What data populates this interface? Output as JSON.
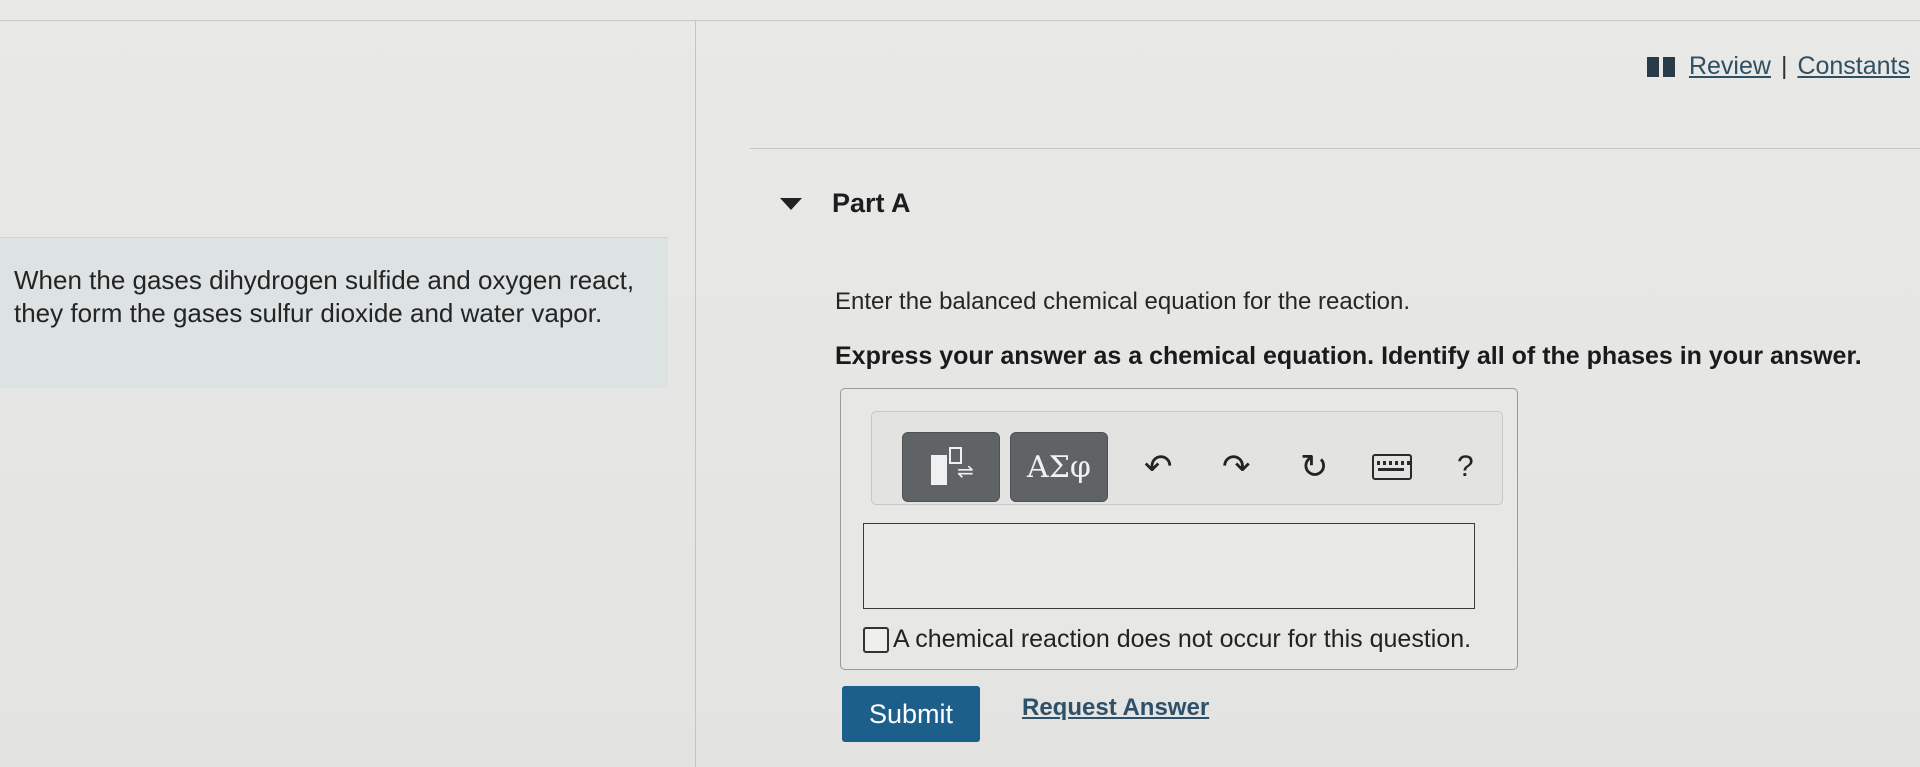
{
  "header_links": {
    "review": "Review",
    "separator": "|",
    "constants": "Constants"
  },
  "problem": {
    "text": "When the gases dihydrogen sulfide and oxygen react, they form the gases sulfur dioxide and water vapor."
  },
  "part": {
    "title": "Part A",
    "instruction": "Enter the balanced chemical equation for the reaction.",
    "instruction_bold": "Express your answer as a chemical equation. Identify all of the phases in your answer."
  },
  "toolbar": {
    "greek_label": "ΑΣφ",
    "undo_glyph": "↶",
    "redo_glyph": "↷",
    "reset_glyph": "↻",
    "help_label": "?",
    "icons": [
      "templates-icon",
      "greek-symbols-icon",
      "undo-icon",
      "redo-icon",
      "reset-icon",
      "keyboard-icon",
      "help-icon"
    ]
  },
  "answer": {
    "value": "",
    "no_reaction_label": "A chemical reaction does not occur for this question.",
    "no_reaction_checked": false
  },
  "actions": {
    "submit_label": "Submit",
    "request_label": "Request Answer"
  },
  "colors": {
    "submit_bg": "#1d5f8b",
    "link": "#2f4f63",
    "problem_bg": "#dde2e3"
  }
}
